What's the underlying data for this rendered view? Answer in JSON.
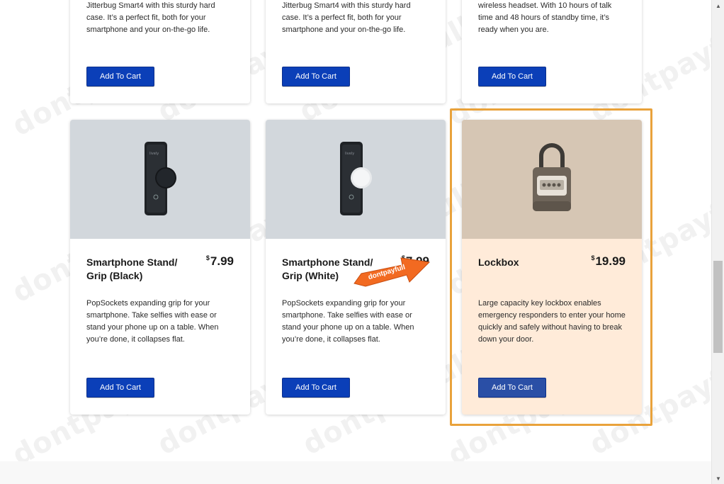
{
  "products_top": [
    {
      "description": "Jitterbug Smart4 with this sturdy hard case. It’s a perfect fit, both for your smartphone and your on-the-go life.",
      "button": "Add To Cart"
    },
    {
      "description": "Jitterbug Smart4 with this sturdy hard case. It’s a perfect fit, both for your smartphone and your on-the-go life.",
      "button": "Add To Cart"
    },
    {
      "description": "wireless headset. With 10 hours of talk time and 48 hours of standby time, it’s ready when you are.",
      "button": "Add To Cart"
    }
  ],
  "products_bottom": [
    {
      "title": "Smartphone Stand/ Grip (Black)",
      "price_currency": "$",
      "price": "7.99",
      "description": "PopSockets expanding grip for your smartphone. Take selfies with ease or stand your phone up on a table. When you’re done, it collapses flat.",
      "button": "Add To Cart",
      "image_icon": "phone-with-black-grip-icon"
    },
    {
      "title": "Smartphone Stand/ Grip (White)",
      "price_currency": "$",
      "price": "7.99",
      "description": "PopSockets expanding grip for your smartphone. Take selfies with ease or stand your phone up on a table. When you’re done, it collapses flat.",
      "button": "Add To Cart",
      "image_icon": "phone-with-white-grip-icon"
    },
    {
      "title": "Lockbox",
      "price_currency": "$",
      "price": "19.99",
      "description": "Large capacity key lockbox enables emergency responders to enter your home quickly and safely without having to break down your door.",
      "button": "Add To Cart",
      "image_icon": "key-lockbox-icon"
    }
  ],
  "promo": {
    "label": "dontpayfull",
    "color": "#f26a21"
  },
  "watermark": {
    "text": "dontpayfull"
  },
  "colors": {
    "button": "#0b3fb8",
    "highlight_border": "#e9a23b",
    "highlight_card": "#ffebd9",
    "image_bg": "#d2d7dc"
  }
}
